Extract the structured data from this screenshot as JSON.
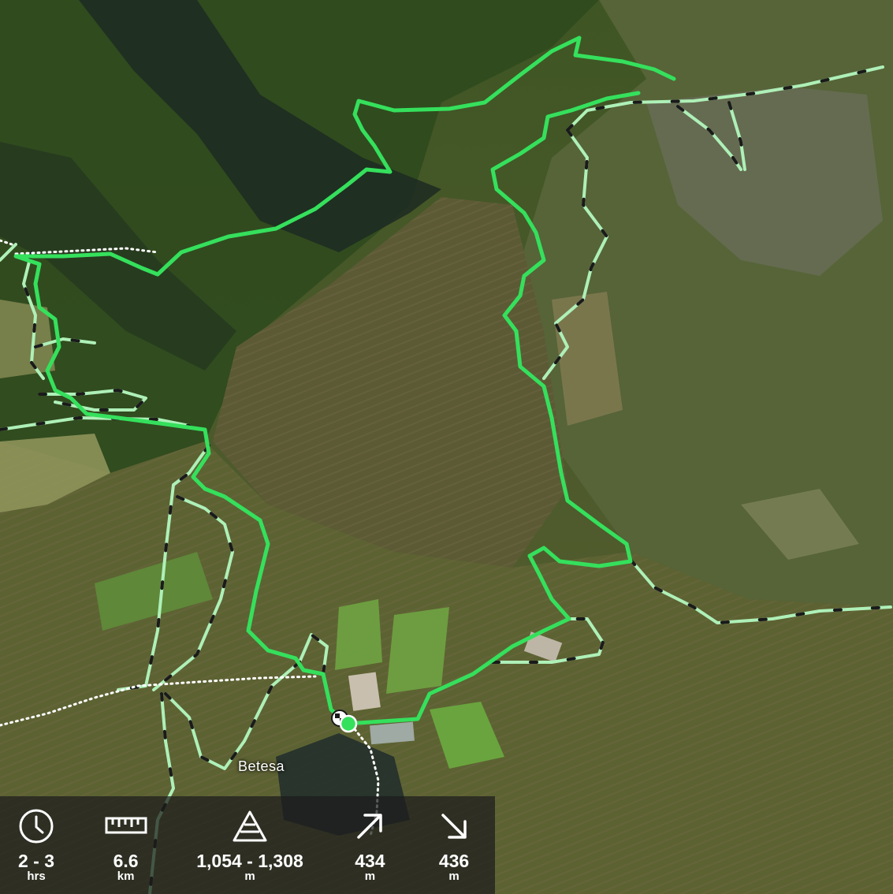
{
  "map": {
    "place_name": "Betesa",
    "colors": {
      "route": "#35e05c",
      "alt_trail": "#aef0b8",
      "trail_dash": "#1a1a1a",
      "footpath": "#ffffff"
    }
  },
  "stats": {
    "duration": {
      "icon": "clock-icon",
      "value": "2 - 3",
      "unit": "hrs"
    },
    "distance": {
      "icon": "ruler-icon",
      "value": "6.6",
      "unit": "km"
    },
    "altitude": {
      "icon": "altitude-icon",
      "value": "1,054 - 1,308",
      "unit": "m"
    },
    "ascent": {
      "icon": "arrow-up-right-icon",
      "value": "434",
      "unit": "m"
    },
    "descent": {
      "icon": "arrow-down-right-icon",
      "value": "436",
      "unit": "m"
    }
  }
}
